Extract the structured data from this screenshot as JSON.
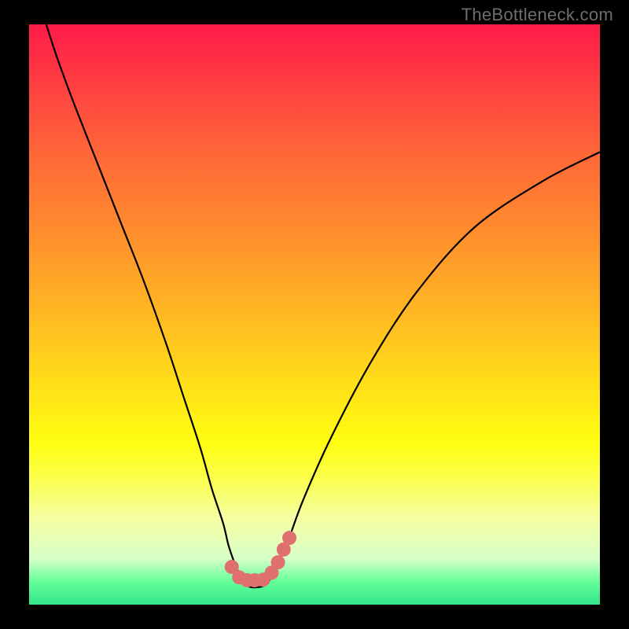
{
  "watermark": "TheBottleneck.com",
  "chart_data": {
    "type": "line",
    "title": "",
    "xlabel": "",
    "ylabel": "",
    "xlim": [
      0,
      100
    ],
    "ylim": [
      0,
      100
    ],
    "series": [
      {
        "name": "bottleneck-curve",
        "x": [
          3,
          5,
          8,
          12,
          16,
          20,
          24,
          27,
          30,
          32,
          34,
          35,
          36.5,
          38,
          39,
          40,
          41,
          42,
          43,
          45,
          48,
          53,
          60,
          68,
          78,
          90,
          100
        ],
        "y": [
          100,
          94,
          86,
          76,
          66,
          56,
          45,
          36,
          27,
          20,
          14,
          10,
          6,
          3.5,
          3,
          3,
          3.2,
          4,
          6,
          10,
          18,
          29,
          42,
          54,
          65,
          73,
          78
        ]
      }
    ],
    "markers": {
      "name": "bottleneck-range-dots",
      "x": [
        35.5,
        36.8,
        38.2,
        39.5,
        41,
        42.5,
        43.6,
        44.6,
        45.6
      ],
      "y": [
        6.5,
        4.7,
        4.2,
        4.2,
        4.3,
        5.5,
        7.3,
        9.5,
        11.5
      ],
      "color": "#e07070",
      "size": 9
    },
    "colors": {
      "gradient_top": "#ff1a48",
      "gradient_bottom": "#33e68c",
      "curve": "#000000"
    }
  }
}
